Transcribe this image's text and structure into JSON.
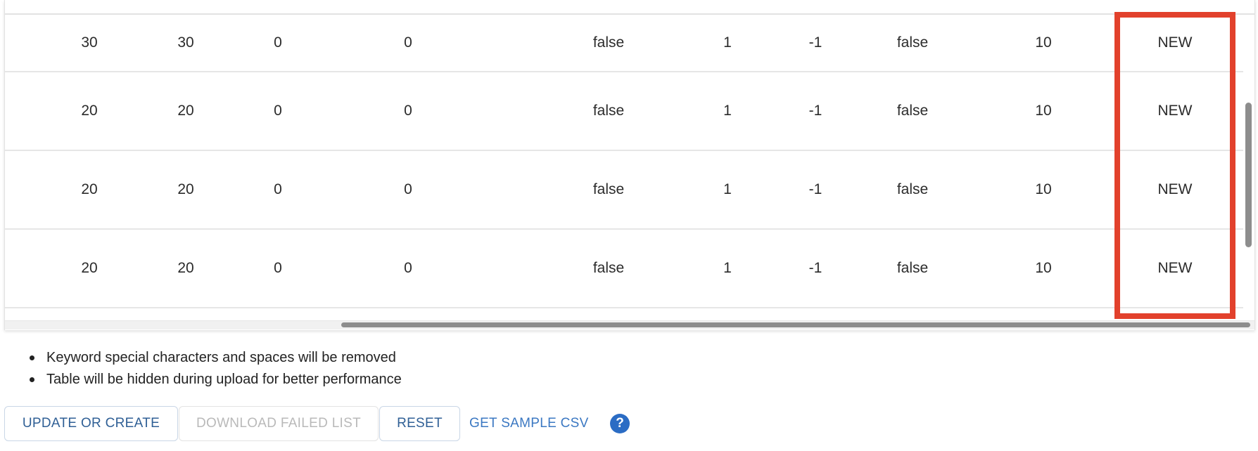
{
  "table": {
    "rows": [
      [
        "30",
        "30",
        "0",
        "0",
        "false",
        "1",
        "-1",
        "false",
        "10",
        "NEW"
      ],
      [
        "20",
        "20",
        "0",
        "0",
        "false",
        "1",
        "-1",
        "false",
        "10",
        "NEW"
      ],
      [
        "20",
        "20",
        "0",
        "0",
        "false",
        "1",
        "-1",
        "false",
        "10",
        "NEW"
      ],
      [
        "20",
        "20",
        "0",
        "0",
        "false",
        "1",
        "-1",
        "false",
        "10",
        "NEW"
      ]
    ]
  },
  "notes": [
    "Keyword special characters and spaces will be removed",
    "Table will be hidden during upload for better performance"
  ],
  "actions": {
    "update_or_create": "UPDATE OR CREATE",
    "download_failed_list": "DOWNLOAD FAILED LIST",
    "reset": "RESET",
    "get_sample_csv": "GET SAMPLE CSV",
    "help": "?"
  },
  "colors": {
    "highlight": "#e2412c",
    "button_text": "#2f5f95",
    "link_text": "#3b78c2",
    "help_icon_bg": "#2b6cc4"
  },
  "icons": {
    "help": "question-circle-icon"
  }
}
